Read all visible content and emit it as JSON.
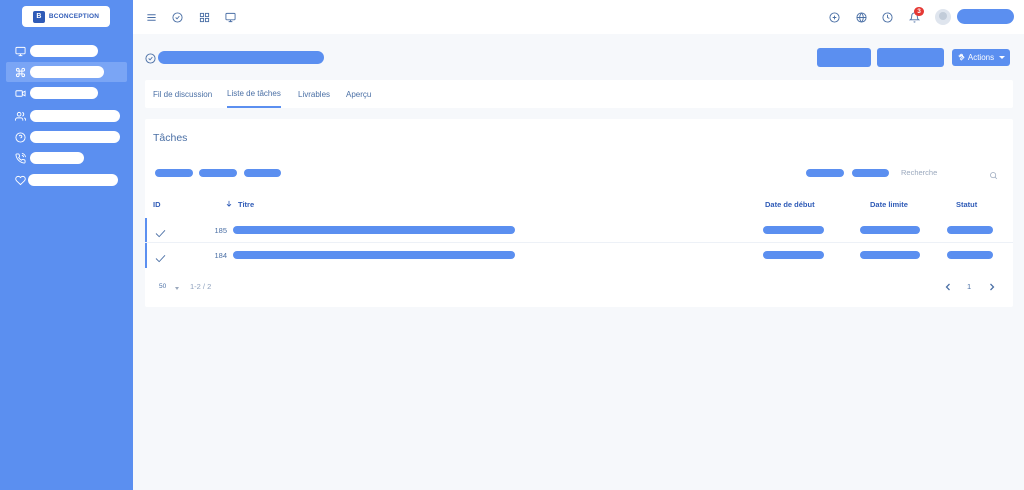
{
  "brand": {
    "logo_text": "BCONCEPTION",
    "logo_mark": "B"
  },
  "colors": {
    "primary": "#5b8ff0",
    "sidebar": "#5b8ff0",
    "text": "#4a6fa5",
    "badge": "#e53935"
  },
  "sidebar": {
    "items": [
      {
        "icon": "monitor-icon"
      },
      {
        "icon": "command-icon",
        "active": true
      },
      {
        "icon": "video-icon"
      },
      {
        "icon": "users-icon"
      },
      {
        "icon": "help-circle-icon"
      },
      {
        "icon": "phone-call-icon"
      },
      {
        "icon": "heart-icon"
      }
    ]
  },
  "topbar": {
    "left_icons": [
      "menu-icon",
      "check-circle-icon",
      "grid-icon",
      "monitor-icon"
    ],
    "right_icons": [
      "plus-circle-icon",
      "globe-icon",
      "clock-icon",
      "bell-icon"
    ],
    "notification_count": "3"
  },
  "header": {
    "actions_label": "Actions"
  },
  "tabs": [
    {
      "label": "Fil de discussion"
    },
    {
      "label": "Liste de tâches",
      "active": true
    },
    {
      "label": "Livrables"
    },
    {
      "label": "Aperçu"
    }
  ],
  "tasks": {
    "title": "Tâches",
    "search_placeholder": "Recherche",
    "columns": {
      "id": "ID",
      "title": "Titre",
      "start": "Date de début",
      "due": "Date limite",
      "status": "Statut"
    },
    "rows": [
      {
        "id": "185"
      },
      {
        "id": "184"
      }
    ],
    "pagination": {
      "page_size": "50",
      "range": "1-2 / 2",
      "current_page": "1"
    }
  }
}
